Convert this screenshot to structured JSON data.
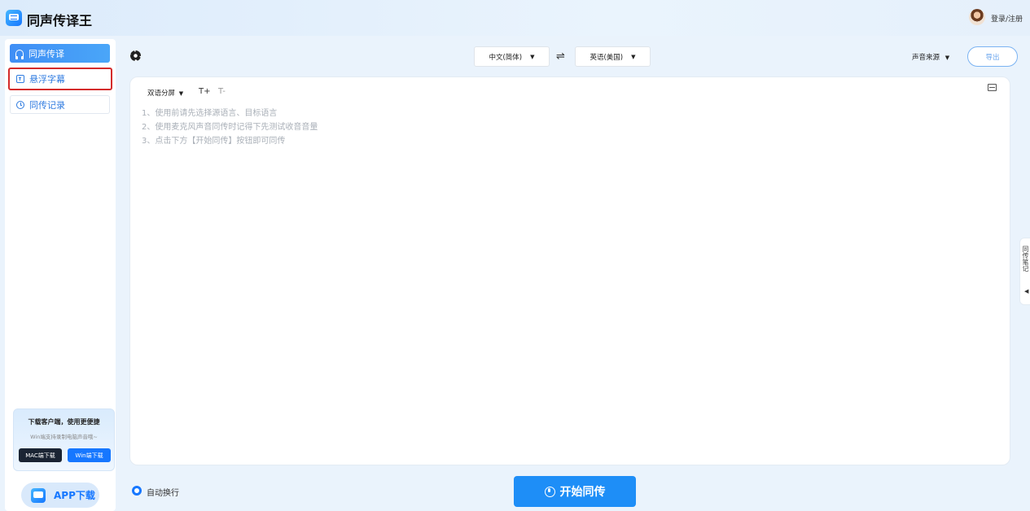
{
  "header": {
    "app_title": "同声传译王",
    "login_label": "登录/注册"
  },
  "sidebar": {
    "items": [
      {
        "label": "同声传译",
        "icon": "headset-icon",
        "active": true
      },
      {
        "label": "悬浮字幕",
        "icon": "caption-icon",
        "active": false
      },
      {
        "label": "同传记录",
        "icon": "clock-icon",
        "active": false
      }
    ],
    "promo": {
      "title": "下载客户端，使用更便捷",
      "subtitle": "Win端支持录制电脑声音哦~",
      "mac_button": "MAC端下载",
      "win_button": "Win端下载"
    },
    "app_download_label": "APP下载"
  },
  "toolbar": {
    "source_language": "中文(简体)",
    "target_language": "英语(美国)",
    "swap_symbol": "⇌",
    "voice_source_label": "声音来源",
    "export_label": "导出"
  },
  "panel": {
    "view_mode_label": "双语分屏",
    "font_increase": "T+",
    "font_decrease": "T-",
    "hints": [
      "1、使用前请先选择源语言、目标语言",
      "2、使用麦克风声音同传时记得下先测试收音音量",
      "3、点击下方【开始同传】按钮即可同传"
    ]
  },
  "side_tab": {
    "label": "同传笔记"
  },
  "bottom": {
    "auto_wrap_label": "自动换行",
    "auto_wrap_checked": true,
    "start_label": "开始同传"
  },
  "colors": {
    "accent": "#1677ff",
    "start_button": "#1e8ef7",
    "highlight_border": "#d42b2b"
  }
}
